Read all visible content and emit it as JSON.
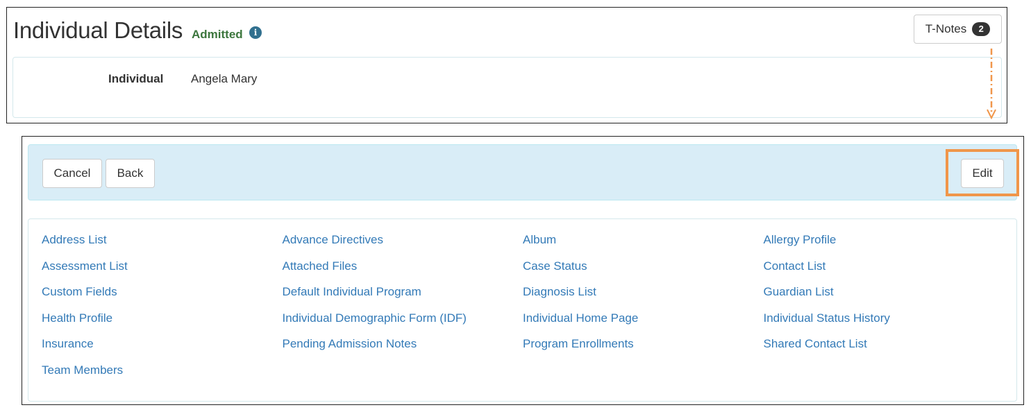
{
  "header": {
    "title": "Individual Details",
    "status": "Admitted",
    "info_icon": "info-circle-icon",
    "tnotes_label": "T-Notes",
    "tnotes_count": "2"
  },
  "individual": {
    "label": "Individual",
    "value": "Angela Mary"
  },
  "toolbar": {
    "cancel_label": "Cancel",
    "back_label": "Back",
    "edit_label": "Edit"
  },
  "links": [
    "Address List",
    "Advance Directives",
    "Album",
    "Allergy Profile",
    "Assessment List",
    "Attached Files",
    "Case Status",
    "Contact List",
    "Custom Fields",
    "Default Individual Program",
    "Diagnosis List",
    "Guardian List",
    "Health Profile",
    "Individual Demographic Form (IDF)",
    "Individual Home Page",
    "Individual Status History",
    "Insurance",
    "Pending Admission Notes",
    "Program Enrollments",
    "Shared Contact List",
    "Team Members"
  ],
  "colors": {
    "status_green": "#3c763d",
    "link_blue": "#337ab7",
    "toolbar_bg": "#d9edf7",
    "annotation_orange": "#f0964a"
  }
}
